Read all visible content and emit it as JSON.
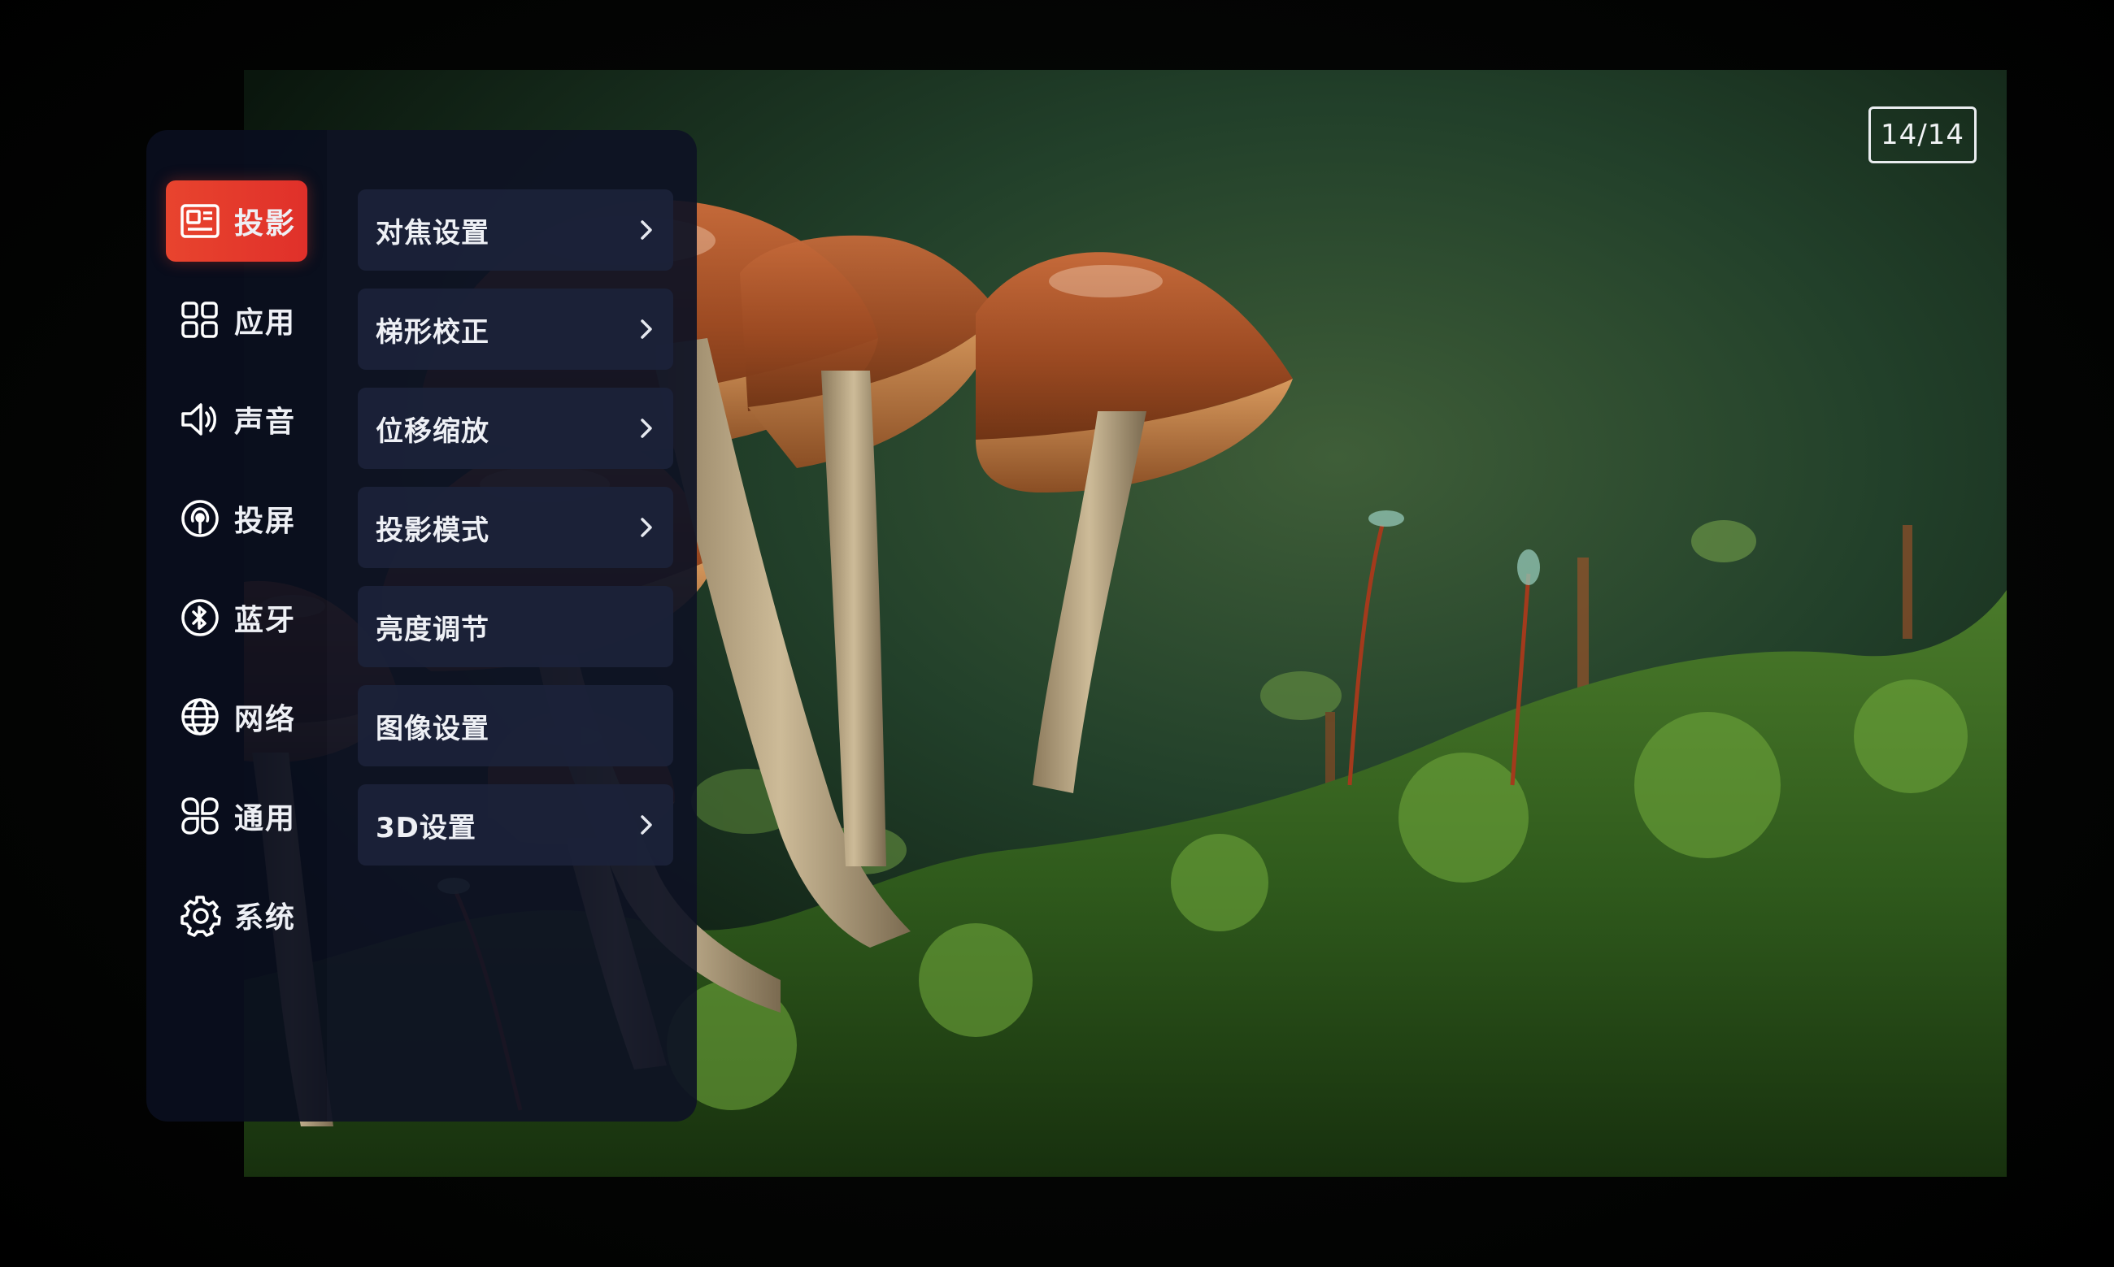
{
  "page_counter": "14/14",
  "nav": {
    "items": [
      {
        "label": "投影",
        "icon": "projection-icon",
        "active": true
      },
      {
        "label": "应用",
        "icon": "apps-icon",
        "active": false
      },
      {
        "label": "声音",
        "icon": "speaker-icon",
        "active": false
      },
      {
        "label": "投屏",
        "icon": "screen-cast-icon",
        "active": false
      },
      {
        "label": "蓝牙",
        "icon": "bluetooth-icon",
        "active": false
      },
      {
        "label": "网络",
        "icon": "globe-icon",
        "active": false
      },
      {
        "label": "通用",
        "icon": "general-icon",
        "active": false
      },
      {
        "label": "系统",
        "icon": "gear-icon",
        "active": false
      }
    ]
  },
  "submenu": {
    "items": [
      {
        "label": "对焦设置",
        "has_arrow": true
      },
      {
        "label": "梯形校正",
        "has_arrow": true
      },
      {
        "label": "位移缩放",
        "has_arrow": true
      },
      {
        "label": "投影模式",
        "has_arrow": true
      },
      {
        "label": "亮度调节",
        "has_arrow": false
      },
      {
        "label": "图像设置",
        "has_arrow": false
      },
      {
        "label": "3D设置",
        "has_arrow": true
      }
    ]
  },
  "colors": {
    "active_accent": "#e8442e",
    "panel_bg": "#0a0e1e",
    "text": "#eef0f5"
  }
}
